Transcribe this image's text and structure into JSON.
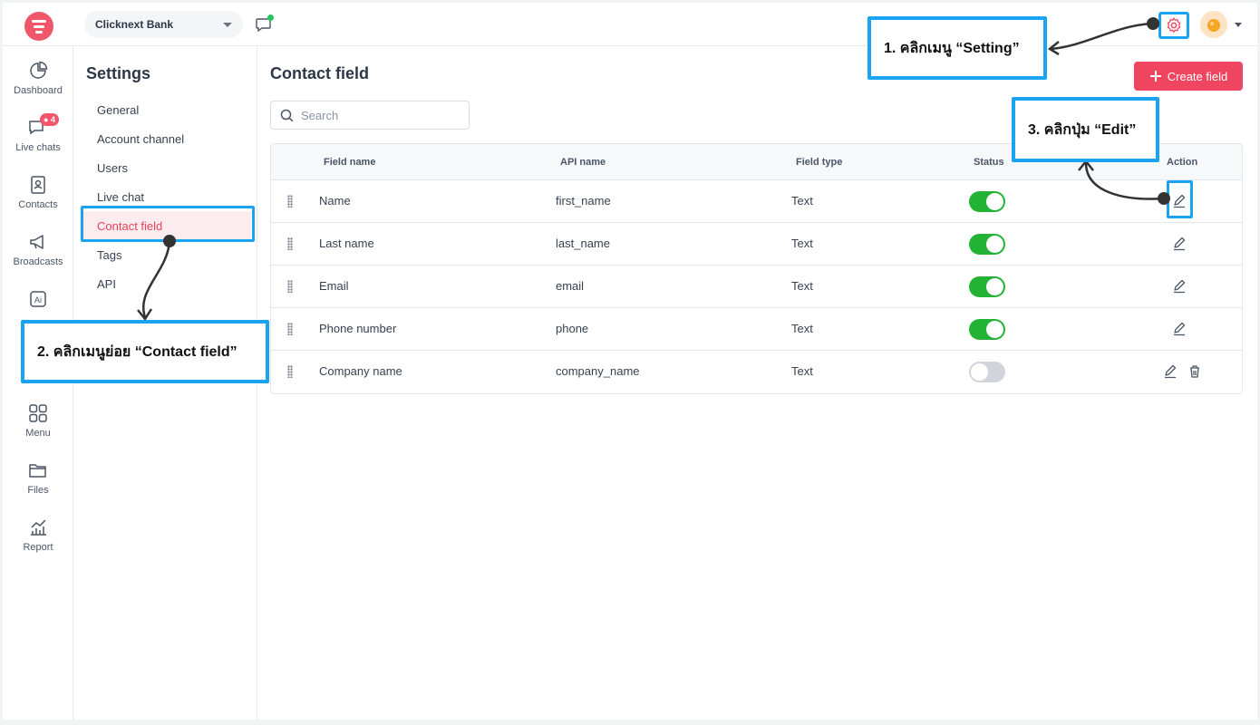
{
  "workspace": {
    "name": "Clicknext Bank"
  },
  "rail": {
    "items": [
      {
        "label": "Dashboard",
        "icon": "pie-chart-icon"
      },
      {
        "label": "Live chats",
        "icon": "chat-icon",
        "badge": "4"
      },
      {
        "label": "Contacts",
        "icon": "contact-book-icon"
      },
      {
        "label": "Broadcasts",
        "icon": "megaphone-icon"
      },
      {
        "label": "",
        "icon": "ai-icon"
      },
      {
        "label": "Menu",
        "icon": "grid-icon"
      },
      {
        "label": "Files",
        "icon": "folder-icon"
      },
      {
        "label": "Report",
        "icon": "report-icon"
      }
    ]
  },
  "settings": {
    "title": "Settings",
    "items": [
      "General",
      "Account channel",
      "Users",
      "Live chat",
      "Contact field",
      "Tags",
      "API"
    ],
    "active": "Contact field"
  },
  "main": {
    "title": "Contact field",
    "create_label": "Create field",
    "search_placeholder": "Search",
    "columns": [
      "Field name",
      "API name",
      "Field type",
      "Status",
      "Action"
    ],
    "rows": [
      {
        "field_name": "Name",
        "api_name": "first_name",
        "field_type": "Text",
        "status": true,
        "deletable": false
      },
      {
        "field_name": "Last name",
        "api_name": "last_name",
        "field_type": "Text",
        "status": true,
        "deletable": false
      },
      {
        "field_name": "Email",
        "api_name": "email",
        "field_type": "Text",
        "status": true,
        "deletable": false
      },
      {
        "field_name": "Phone number",
        "api_name": "phone",
        "field_type": "Text",
        "status": true,
        "deletable": false
      },
      {
        "field_name": "Company name",
        "api_name": "company_name",
        "field_type": "Text",
        "status": false,
        "deletable": true
      }
    ]
  },
  "callouts": {
    "step1": "1. คลิกเมนู “Setting”",
    "step2": "2. คลิกเมนูย่อย “Contact field”",
    "step3": "3. คลิกปุ่ม “Edit”"
  },
  "colors": {
    "accent": "#f04560",
    "callout_border": "#1aa3f0",
    "toggle_on": "#22b335"
  }
}
